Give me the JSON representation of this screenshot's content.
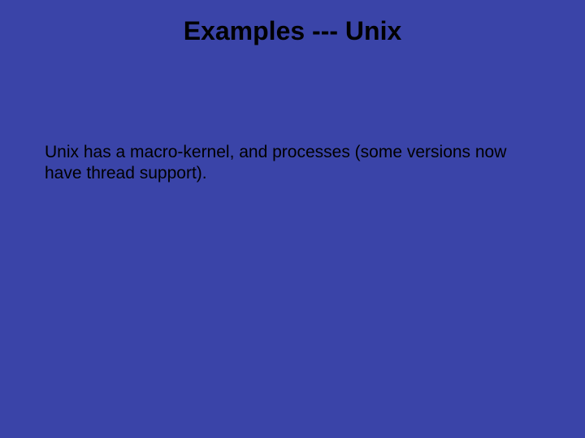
{
  "slide": {
    "title": "Examples --- Unix",
    "body": "Unix has a macro-kernel, and processes (some versions now have thread support)."
  }
}
